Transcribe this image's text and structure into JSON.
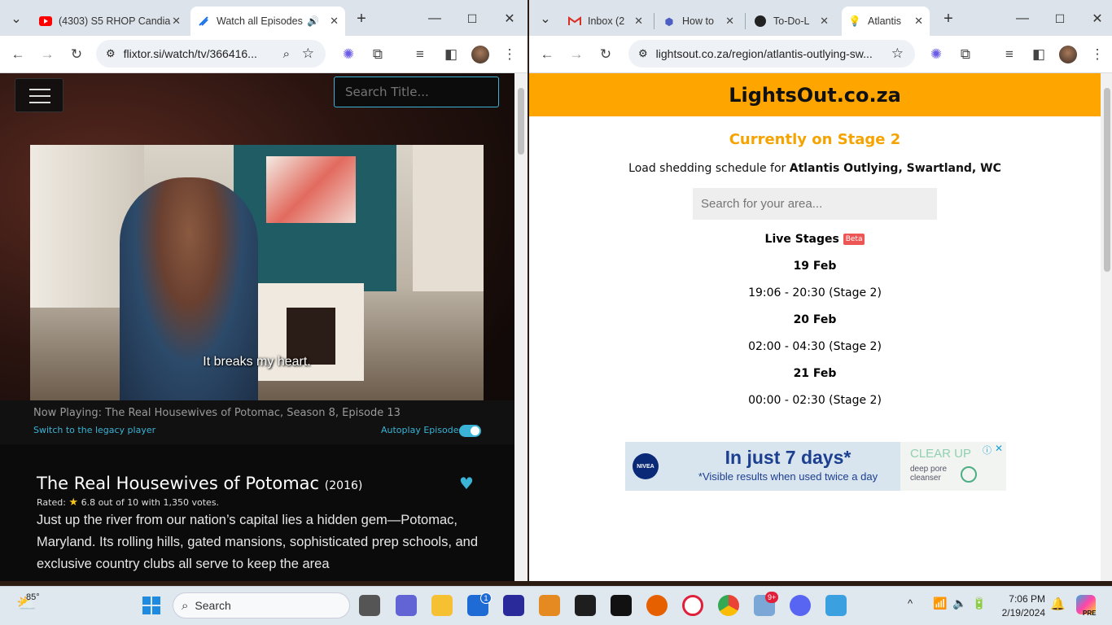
{
  "left_window": {
    "tabs": [
      {
        "label": "(4303) S5 RHOP Candia",
        "active": false
      },
      {
        "label": "Watch all Episodes",
        "active": true
      }
    ],
    "new_tab": "+",
    "url": "flixtor.si/watch/tv/366416...",
    "page": {
      "search_placeholder": "Search Title...",
      "subtitle": "It breaks my heart.",
      "now_playing": "Now Playing: The Real Housewives of Potomac, Season 8, Episode 13",
      "legacy_link": "Switch to the legacy player",
      "autoplay_label": "Autoplay Episodes",
      "show_title": "The Real Housewives of Potomac",
      "show_year": "(2016)",
      "rated_label": "Rated:",
      "rating_value": "6.8",
      "rating_rest": "out of 10 with 1,350 votes.",
      "description": "Just up the river from our nation’s capital lies a hidden gem—Potomac, Maryland. Its rolling hills, gated mansions, sophisticated prep schools, and exclusive country clubs all serve to keep the area"
    }
  },
  "right_window": {
    "tabs": [
      {
        "label": "Inbox (2"
      },
      {
        "label": "How to"
      },
      {
        "label": "To-Do-L"
      },
      {
        "label": "Atlantis"
      }
    ],
    "new_tab": "+",
    "url": "lightsout.co.za/region/atlantis-outlying-sw...",
    "page": {
      "brand": "LightsOut.co.za",
      "stage_heading": "Currently on Stage 2",
      "schedule_prefix": "Load shedding schedule for",
      "schedule_area": "Atlantis Outlying, Swartland, WC",
      "search_placeholder": "Search for your area...",
      "live_stages": "Live Stages",
      "beta_badge": "Beta",
      "days": [
        {
          "date": "19 Feb",
          "slot": "19:06 - 20:30 (Stage 2)"
        },
        {
          "date": "20 Feb",
          "slot": "02:00 - 04:30 (Stage 2)"
        },
        {
          "date": "21 Feb",
          "slot": "00:00 - 02:30 (Stage 2)"
        }
      ],
      "ad": {
        "logo": "NIVEA",
        "headline": "In just 7 days*",
        "subline": "*Visible results when used twice a day",
        "product": "CLEAR UP",
        "product_sub": "deep pore cleanser"
      }
    }
  },
  "taskbar": {
    "weather_temp": "85°",
    "search_label": "Search",
    "time": "7:06 PM",
    "date": "2/19/2024",
    "badge_store": "1",
    "badge_opera": "9+",
    "pre_label": "PRE"
  }
}
